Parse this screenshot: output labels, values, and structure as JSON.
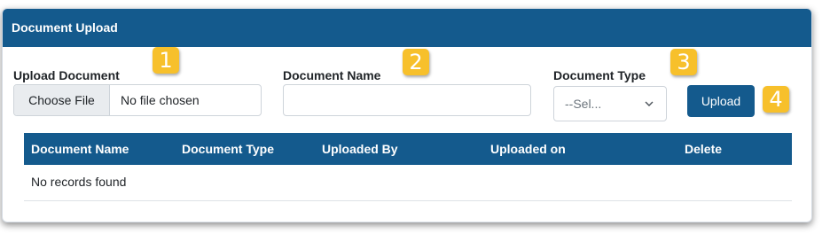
{
  "panel": {
    "title": "Document Upload"
  },
  "form": {
    "upload_document_label": "Upload Document",
    "choose_file_label": "Choose File",
    "file_status": "No file chosen",
    "document_name_label": "Document Name",
    "document_name_value": "",
    "document_type_label": "Document Type",
    "document_type_selected": "--Sel...",
    "upload_button": "Upload"
  },
  "callouts": [
    "1",
    "2",
    "3",
    "4"
  ],
  "table": {
    "columns": [
      "Document Name",
      "Document Type",
      "Uploaded By",
      "Uploaded on",
      "Delete"
    ],
    "empty_message": "No records found"
  },
  "colors": {
    "header_bg": "#145a8d",
    "callout": "#f7c02b"
  }
}
